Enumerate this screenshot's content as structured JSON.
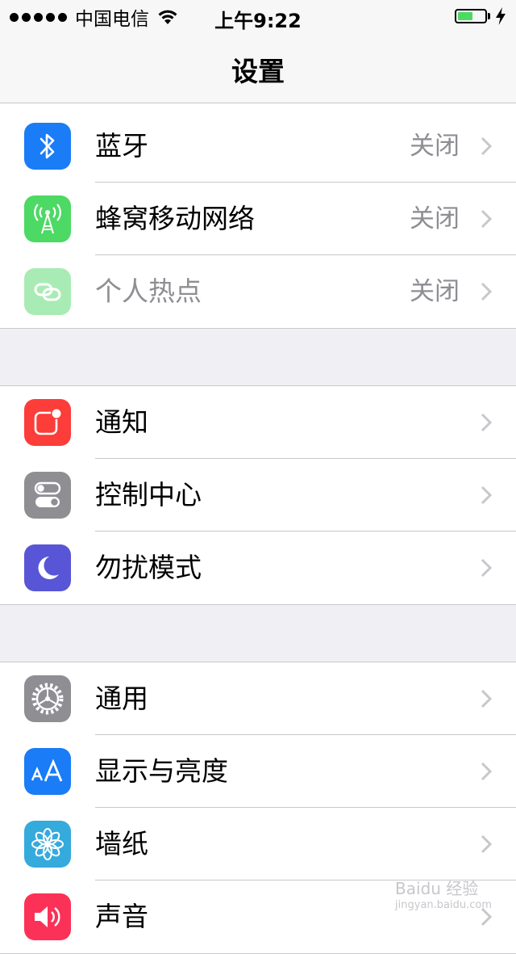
{
  "status_bar": {
    "carrier": "中国电信",
    "time": "上午9:22",
    "battery_level": 0.55
  },
  "navbar": {
    "title": "设置"
  },
  "groups": [
    [
      {
        "label": "蓝牙",
        "value": "关闭",
        "icon": "bluetooth-icon",
        "color": "#1a7cf6"
      },
      {
        "label": "蜂窝移动网络",
        "value": "关闭",
        "icon": "cellular-antenna-icon",
        "color": "#4cd964"
      },
      {
        "label": "个人热点",
        "value": "关闭",
        "icon": "hotspot-chain-icon",
        "color": "#a9ebb4",
        "disabled": true
      }
    ],
    [
      {
        "label": "通知",
        "value": "",
        "icon": "notification-icon",
        "color": "#fc3d39"
      },
      {
        "label": "控制中心",
        "value": "",
        "icon": "control-center-icon",
        "color": "#8e8e93"
      },
      {
        "label": "勿扰模式",
        "value": "",
        "icon": "moon-icon",
        "color": "#5856d6"
      }
    ],
    [
      {
        "label": "通用",
        "value": "",
        "icon": "gear-icon",
        "color": "#8e8e93"
      },
      {
        "label": "显示与亮度",
        "value": "",
        "icon": "text-size-icon",
        "color": "#1a7cf6"
      },
      {
        "label": "墙纸",
        "value": "",
        "icon": "wallpaper-flower-icon",
        "color": "#35aadc"
      },
      {
        "label": "声音",
        "value": "",
        "icon": "speaker-icon",
        "color": "#fc3158"
      }
    ]
  ],
  "watermark": {
    "text": "Baidu 经验",
    "sub": "jingyan.baidu.com"
  }
}
